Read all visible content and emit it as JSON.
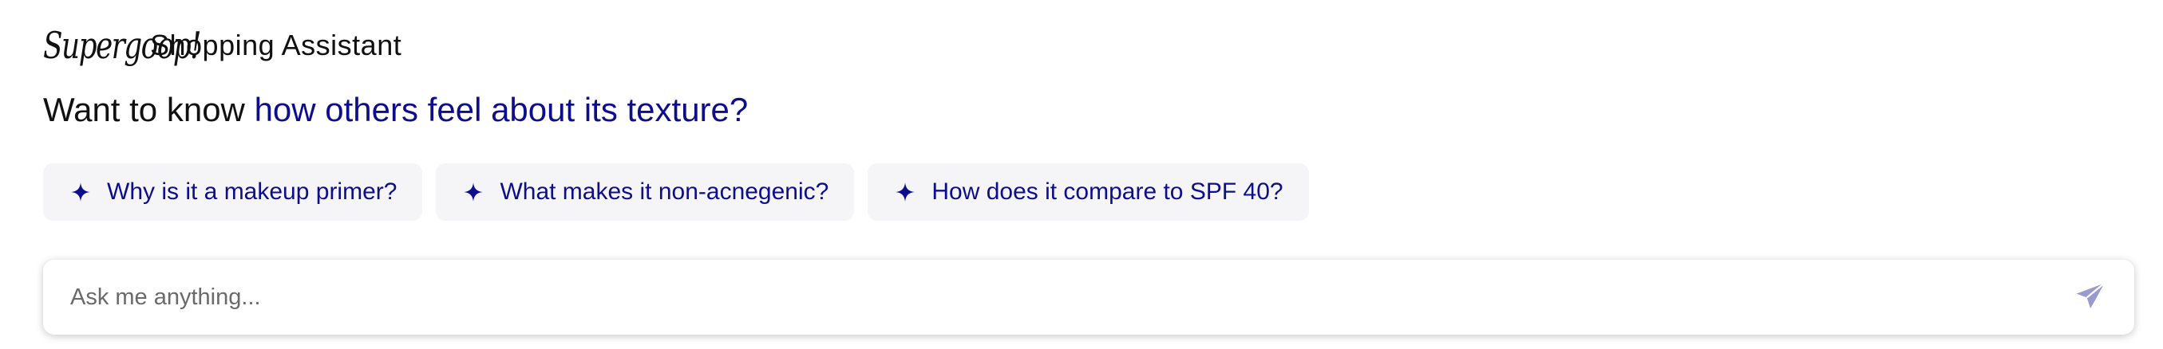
{
  "header": {
    "brand": "Supergoop!",
    "title": "Shopping Assistant"
  },
  "prompt": {
    "lead": "Want to know ",
    "highlight": "how others feel about its texture?"
  },
  "suggestions": [
    {
      "label": "Why is it a makeup primer?",
      "icon": "sparkle-icon"
    },
    {
      "label": "What makes it non-acnegenic?",
      "icon": "sparkle-icon"
    },
    {
      "label": "How does it compare to SPF 40?",
      "icon": "sparkle-icon"
    }
  ],
  "chat": {
    "placeholder": "Ask me anything...",
    "send_icon": "paper-plane-icon"
  },
  "colors": {
    "accent": "#0e0e8c",
    "chip_bg": "#f5f5f7",
    "send_icon": "#9a9ad0"
  }
}
